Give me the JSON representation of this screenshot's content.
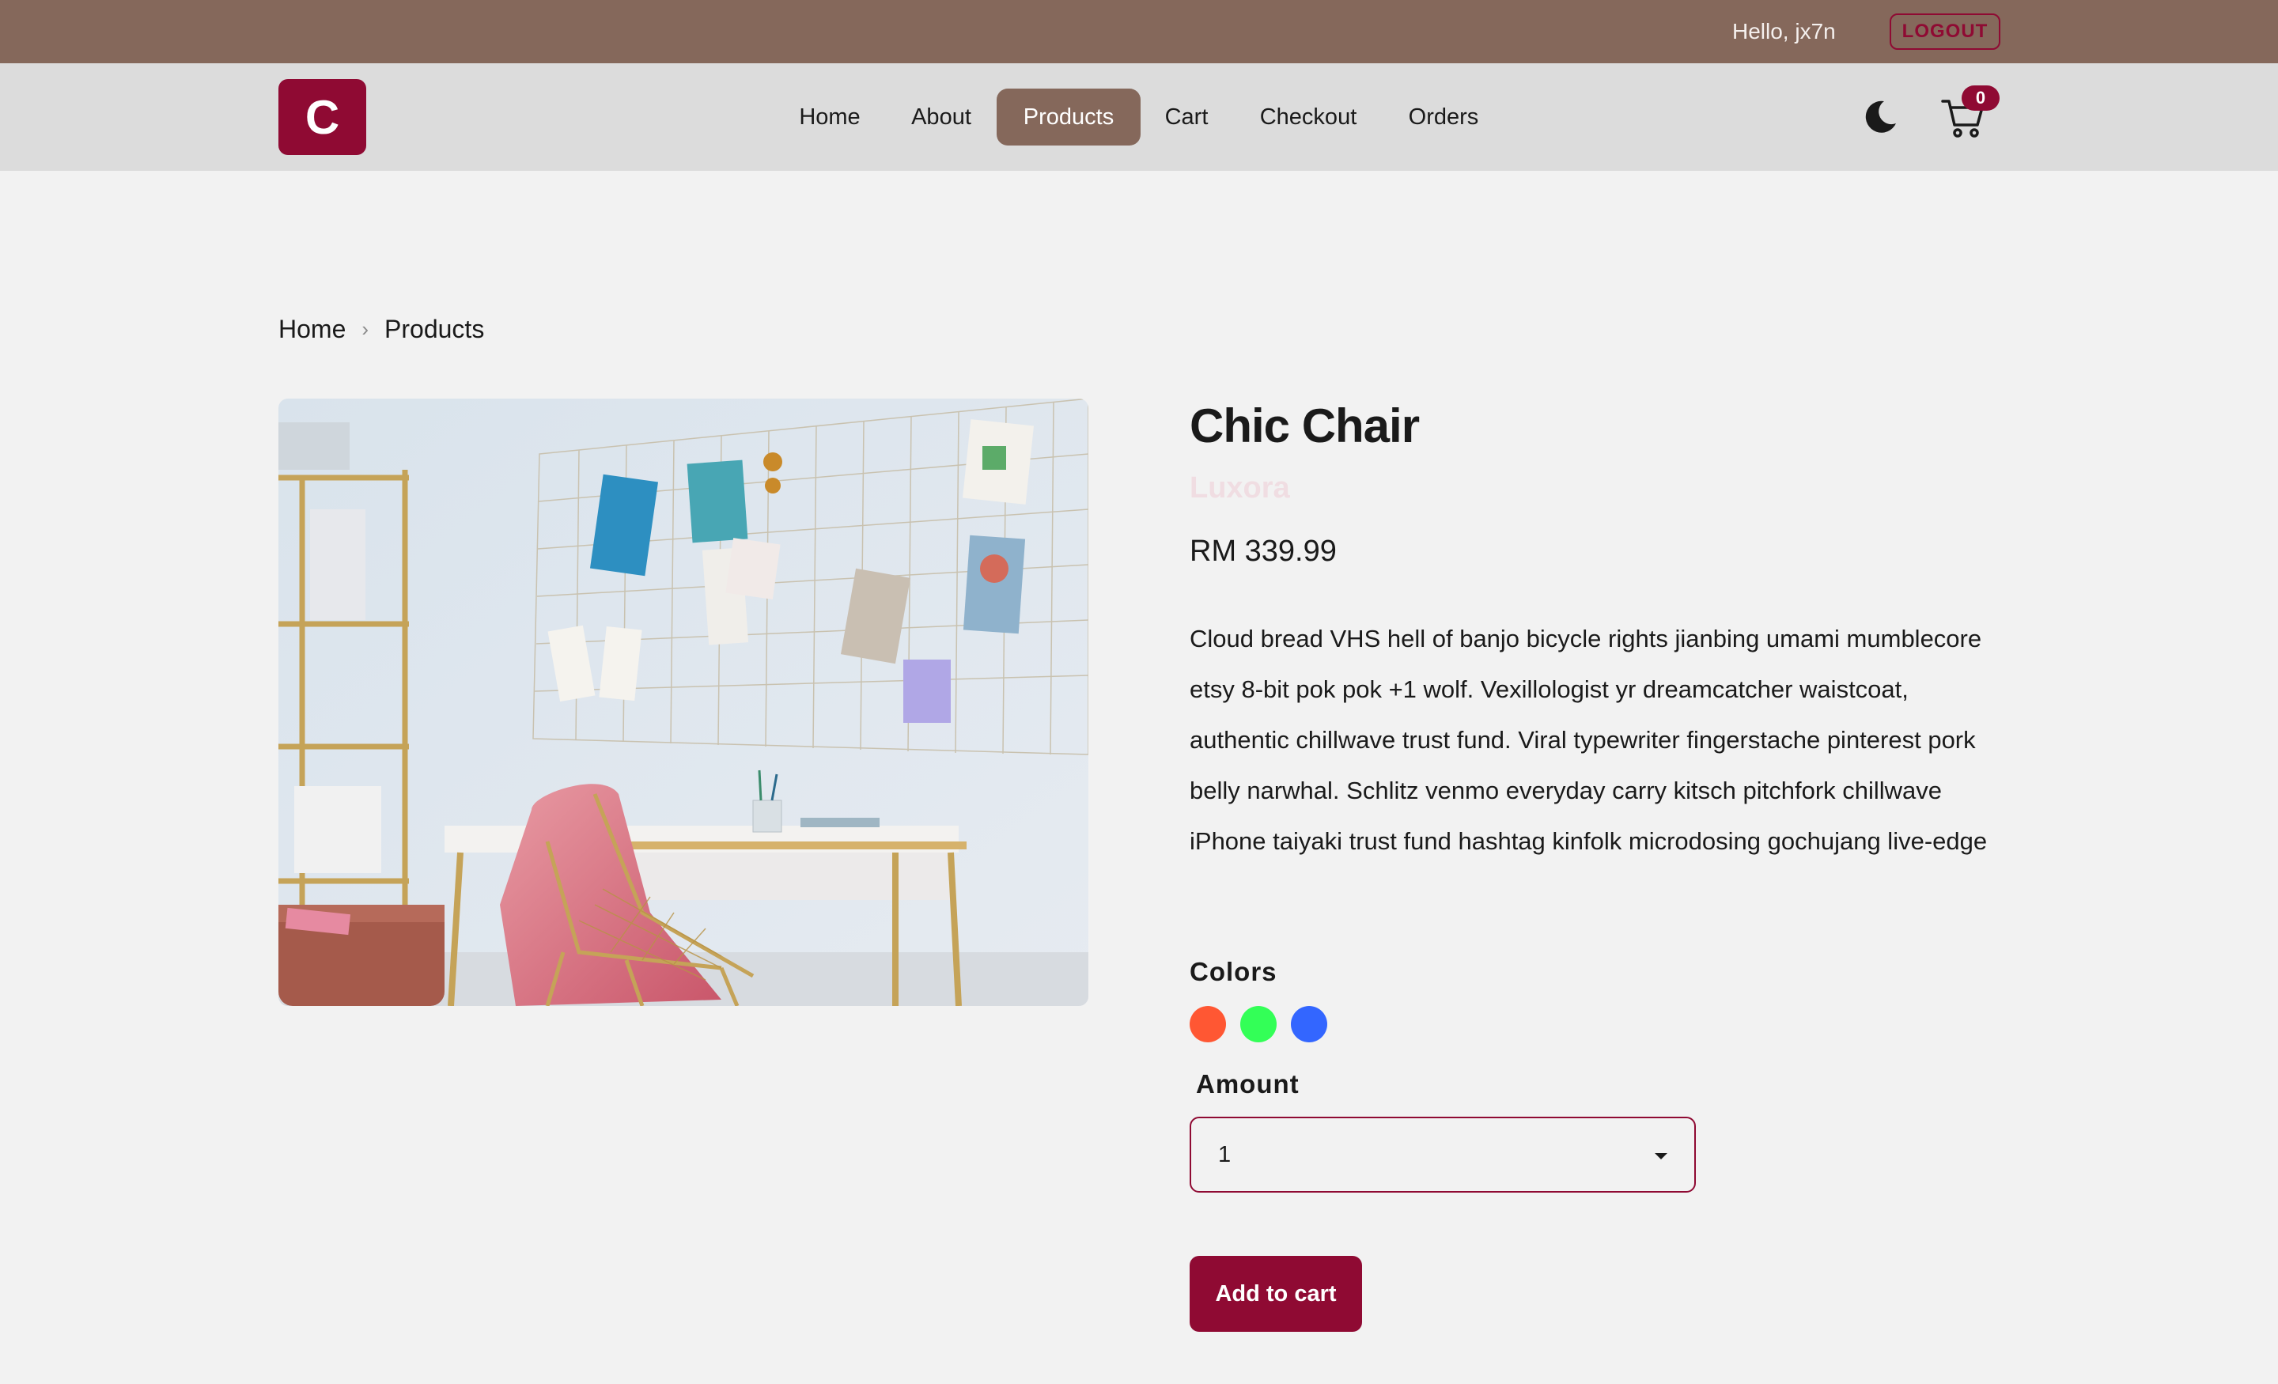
{
  "topbar": {
    "greeting": "Hello, jx7n",
    "logout_label": "LOGOUT"
  },
  "nav": {
    "logo_letter": "C",
    "links": [
      {
        "label": "Home",
        "active": false
      },
      {
        "label": "About",
        "active": false
      },
      {
        "label": "Products",
        "active": true
      },
      {
        "label": "Cart",
        "active": false
      },
      {
        "label": "Checkout",
        "active": false
      },
      {
        "label": "Orders",
        "active": false
      }
    ],
    "theme_icon": "moon-icon",
    "cart_icon": "cart-icon",
    "cart_count": "0"
  },
  "breadcrumb": {
    "items": [
      "Home",
      "Products"
    ]
  },
  "product": {
    "image_icon": "product-photo",
    "title": "Chic Chair",
    "company": "Luxora",
    "price": "RM 339.99",
    "description": "Cloud bread VHS hell of banjo bicycle rights jianbing umami mumblecore etsy 8-bit pok pok +1 wolf. Vexillologist yr dreamcatcher waistcoat, authentic chillwave trust fund. Viral typewriter fingerstache pinterest pork belly narwhal. Schlitz venmo everyday carry kitsch pitchfork chillwave iPhone taiyaki trust fund hashtag kinfolk microdosing gochujang live-edge",
    "colors_label": "Colors",
    "colors": [
      "#ff5733",
      "#33ff57",
      "#3366ff"
    ],
    "amount_label": "Amount",
    "amount_value": "1",
    "add_to_cart_label": "Add to cart"
  },
  "theme": {
    "brand": "#8f0a33",
    "topbar_bg": "#85685b",
    "navbar_bg": "#dcdcdc",
    "page_bg": "#f2f2f2"
  }
}
